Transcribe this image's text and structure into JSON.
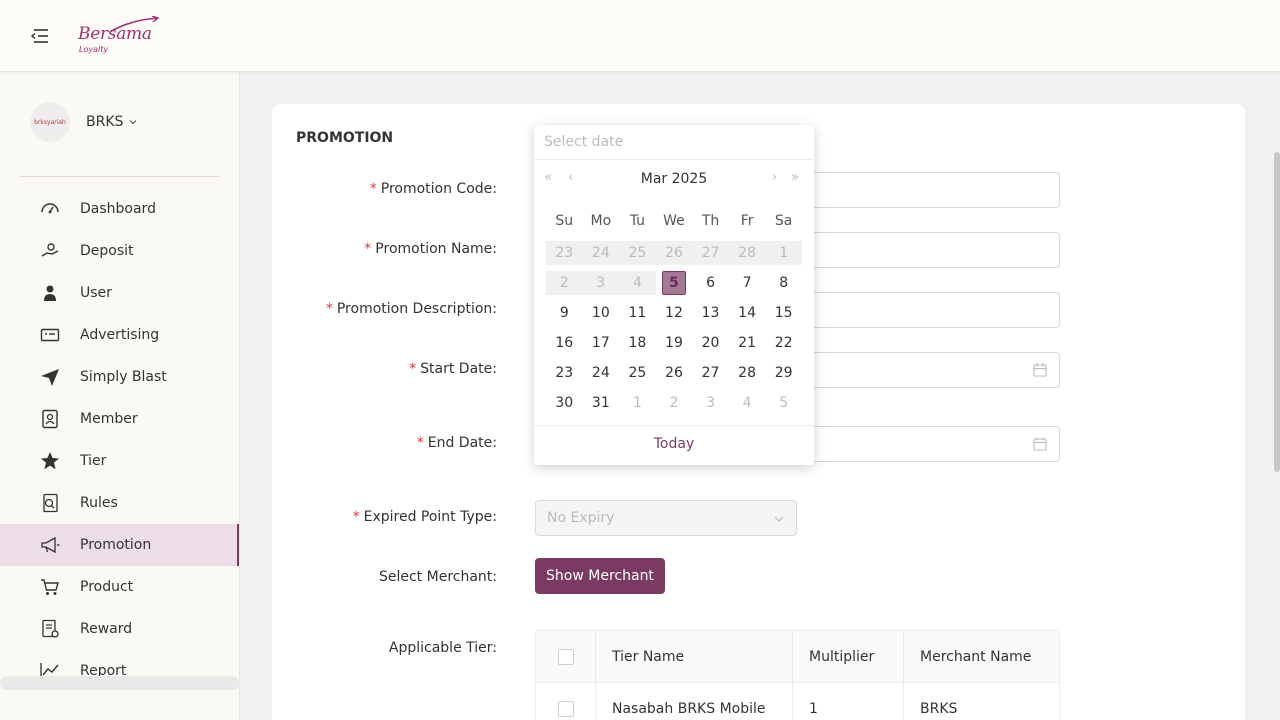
{
  "header": {
    "logo_text": "Bersama",
    "logo_sub": "Loyalty"
  },
  "sidebar": {
    "brand": {
      "name": "BRKS",
      "avatar_text": "brksyariah"
    },
    "items": [
      {
        "label": "Dashboard",
        "icon": "dashboard-icon"
      },
      {
        "label": "Deposit",
        "icon": "deposit-icon"
      },
      {
        "label": "User",
        "icon": "user-icon"
      },
      {
        "label": "Advertising",
        "icon": "advertising-icon"
      },
      {
        "label": "Simply Blast",
        "icon": "send-icon"
      },
      {
        "label": "Member",
        "icon": "member-icon"
      },
      {
        "label": "Tier",
        "icon": "star-icon"
      },
      {
        "label": "Rules",
        "icon": "rules-icon"
      },
      {
        "label": "Promotion",
        "icon": "megaphone-icon",
        "active": true
      },
      {
        "label": "Product",
        "icon": "cart-icon"
      },
      {
        "label": "Reward",
        "icon": "reward-icon"
      },
      {
        "label": "Report",
        "icon": "chart-line-icon"
      }
    ]
  },
  "form": {
    "title": "PROMOTION",
    "promotion_code_label": "Promotion Code",
    "promotion_name_label": "Promotion Name",
    "promotion_description_label": "Promotion Description",
    "start_date_label": "Start Date",
    "end_date_label": "End Date",
    "expired_point_type_label": "Expired Point Type",
    "expired_point_type_value": "No Expiry",
    "select_merchant_label": "Select Merchant",
    "show_merchant_button": "Show Merchant",
    "applicable_tier_label": "Applicable Tier",
    "colon": ":",
    "required_mark": "*"
  },
  "tier_table": {
    "columns": [
      "Tier Name",
      "Multiplier",
      "Merchant Name"
    ],
    "rows": [
      {
        "tier_name": "Nasabah BRKS Mobile",
        "multiplier": "1",
        "merchant_name": "BRKS"
      }
    ]
  },
  "datepicker": {
    "placeholder": "Select date",
    "month_year": "Mar 2025",
    "prev_year": "«",
    "prev_month": "‹",
    "next_month": "›",
    "next_year": "»",
    "weekdays": [
      "Su",
      "Mo",
      "Tu",
      "We",
      "Th",
      "Fr",
      "Sa"
    ],
    "weeks": [
      [
        "23",
        "24",
        "25",
        "26",
        "27",
        "28",
        "1"
      ],
      [
        "2",
        "3",
        "4",
        "5",
        "6",
        "7",
        "8"
      ],
      [
        "9",
        "10",
        "11",
        "12",
        "13",
        "14",
        "15"
      ],
      [
        "16",
        "17",
        "18",
        "19",
        "20",
        "21",
        "22"
      ],
      [
        "23",
        "24",
        "25",
        "26",
        "27",
        "28",
        "29"
      ],
      [
        "30",
        "31",
        "1",
        "2",
        "3",
        "4",
        "5"
      ]
    ],
    "selected_day": "5",
    "today_label": "Today"
  },
  "colors": {
    "accent": "#7b3a62",
    "active_bg": "#ecdde7",
    "required": "#e0383e"
  }
}
